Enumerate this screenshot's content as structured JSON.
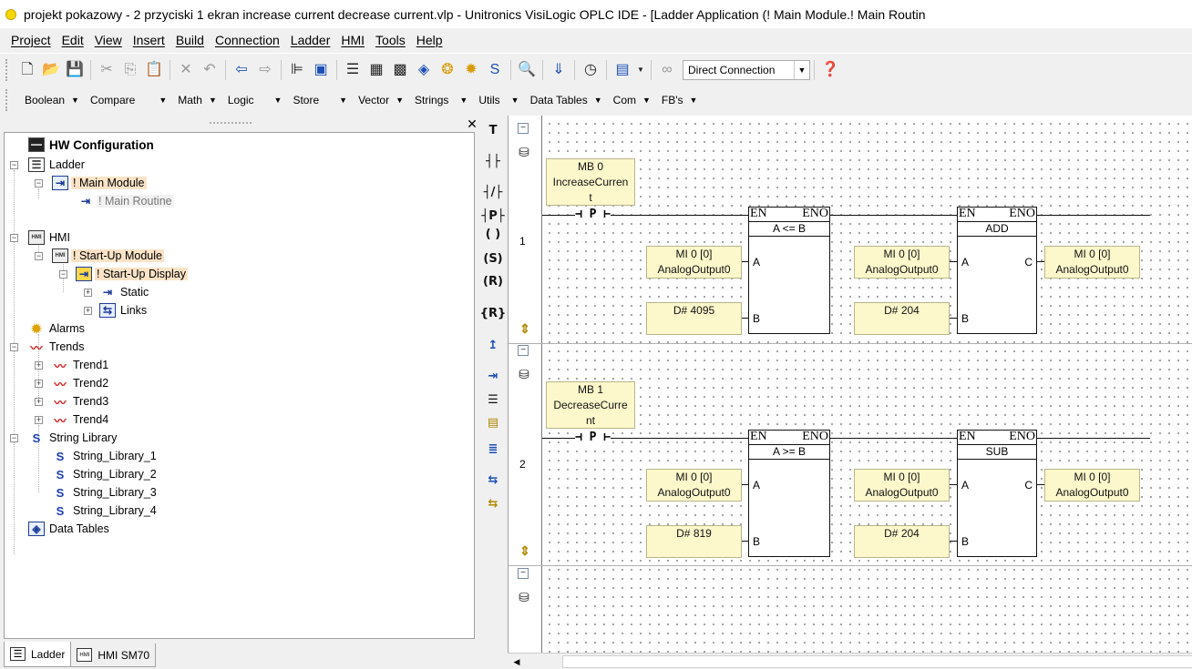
{
  "window": {
    "title": "projekt pokazowy - 2 przyciski 1 ekran increase current decrease current.vlp - Unitronics VisiLogic OPLC IDE - [Ladder Application (! Main Module.! Main Routin"
  },
  "menu": [
    "Project",
    "Edit",
    "View",
    "Insert",
    "Build",
    "Connection",
    "Ladder",
    "HMI",
    "Tools",
    "Help"
  ],
  "toolbar": {
    "connection": "Direct Connection"
  },
  "function_menus": [
    "Boolean",
    "Compare",
    "Math",
    "Logic",
    "Store",
    "Vector",
    "Strings",
    "Utils",
    "Data Tables",
    "Com",
    "FB's"
  ],
  "tree": {
    "hw": "HW Configuration",
    "ladder": "Ladder",
    "main_module": "! Main Module",
    "main_routine": "! Main Routine",
    "hmi": "HMI",
    "startup_module": "! Start-Up Module",
    "startup_display": "! Start-Up Display",
    "static": "Static",
    "links": "Links",
    "alarms": "Alarms",
    "trends": "Trends",
    "trend1": "Trend1",
    "trend2": "Trend2",
    "trend3": "Trend3",
    "trend4": "Trend4",
    "string_library": "String Library",
    "sl1": "String_Library_1",
    "sl2": "String_Library_2",
    "sl3": "String_Library_3",
    "sl4": "String_Library_4",
    "data_tables": "Data Tables"
  },
  "tabs": {
    "ladder": "Ladder",
    "hmi": "HMI SM70"
  },
  "rungs": [
    {
      "num": "1",
      "contact_op": {
        "l1": "MB 0",
        "l2": "IncreaseCurren",
        "l3": "t"
      },
      "contact": "⊣ P ⊢",
      "f1": {
        "en": "EN",
        "eno": "ENO",
        "op": "A <= B",
        "a_l1": "MI 0 [0]",
        "a_l2": "AnalogOutput0",
        "b": "D# 4095"
      },
      "f2": {
        "en": "EN",
        "eno": "ENO",
        "op": "ADD",
        "a_l1": "MI 0 [0]",
        "a_l2": "AnalogOutput0",
        "b": "D# 204",
        "c_l1": "MI 0 [0]",
        "c_l2": "AnalogOutput0"
      }
    },
    {
      "num": "2",
      "contact_op": {
        "l1": "MB 1",
        "l2": "DecreaseCurre",
        "l3": "nt"
      },
      "contact": "⊣ P ⊢",
      "f1": {
        "en": "EN",
        "eno": "ENO",
        "op": "A >= B",
        "a_l1": "MI 0 [0]",
        "a_l2": "AnalogOutput0",
        "b": "D# 819"
      },
      "f2": {
        "en": "EN",
        "eno": "ENO",
        "op": "SUB",
        "a_l1": "MI 0 [0]",
        "a_l2": "AnalogOutput0",
        "b": "D# 204",
        "c_l1": "MI 0 [0]",
        "c_l2": "AnalogOutput0"
      }
    }
  ],
  "pins": {
    "a": "A",
    "b": "B",
    "c": "C"
  },
  "palette": [
    "contact-no",
    "contact-nc",
    "contact-p",
    "coil",
    "coil-set",
    "coil-reset",
    "coil-r",
    "branch-up"
  ]
}
